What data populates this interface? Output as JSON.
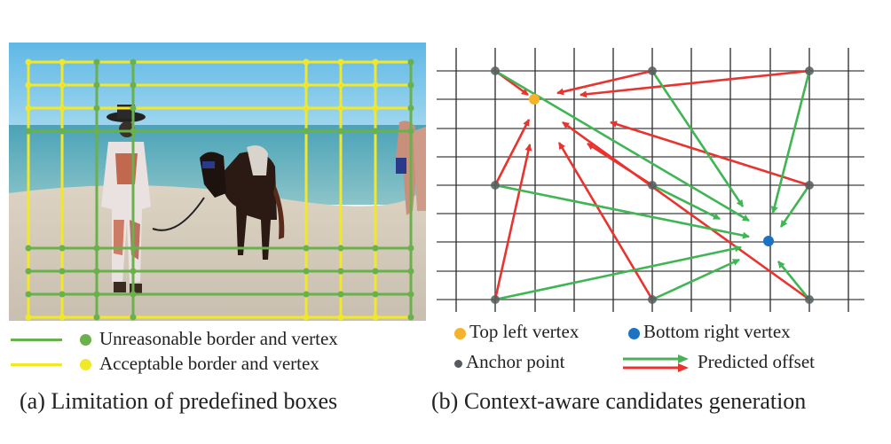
{
  "panel_a": {
    "description": "beach photo with man leading horse, overlaid with box grid",
    "legend": [
      {
        "color": "#6ab04c",
        "label": "Unreasonable  border and vertex"
      },
      {
        "color": "#f2e82a",
        "label": "Acceptable  border and vertex"
      }
    ],
    "caption": "(a) Limitation  of predefined boxes"
  },
  "panel_b": {
    "legend": {
      "top_left": {
        "color": "#f4b32a",
        "label": "Top left vertex"
      },
      "bottom_right": {
        "color": "#1e72c4",
        "label": "Bottom right vertex"
      },
      "anchor": {
        "color": "#555a60",
        "label": "Anchor point"
      },
      "offset": {
        "label": "Predicted offset",
        "colors": [
          "#4cb05a",
          "#e8332f"
        ]
      }
    },
    "caption": "(b) Context-aware candidates generation"
  },
  "colors": {
    "green": "#3fb554",
    "red": "#e8332f",
    "yellow": "#f2e82a",
    "grid_green": "#6ab04c",
    "orange": "#f4b32a",
    "blue": "#1e72c4",
    "anchor": "#555a60"
  }
}
